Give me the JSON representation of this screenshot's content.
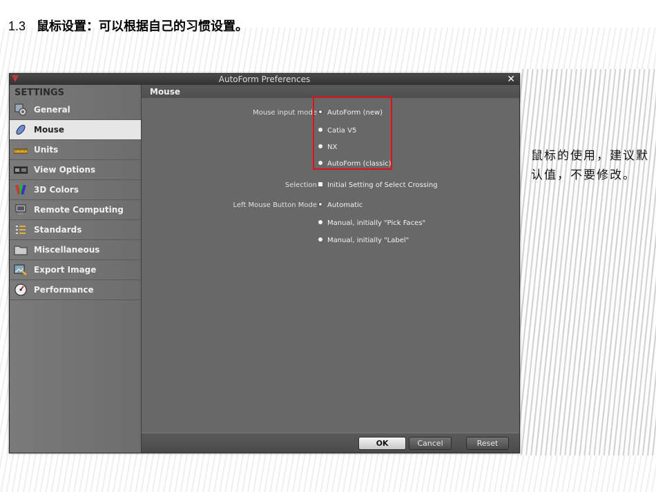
{
  "slide": {
    "section_number": "1.3",
    "title": "鼠标设置：可以根据自己的习惯设置。",
    "note": "鼠标的使用，建议默认值，不要修改。"
  },
  "window": {
    "title": "AutoForm Preferences",
    "close_label": "✕"
  },
  "sidebar": {
    "heading": "SETTINGS",
    "items": [
      {
        "label": "General",
        "icon": "general-icon"
      },
      {
        "label": "Mouse",
        "icon": "mouse-icon",
        "active": true
      },
      {
        "label": "Units",
        "icon": "ruler-icon"
      },
      {
        "label": "View Options",
        "icon": "view-options-icon"
      },
      {
        "label": "3D Colors",
        "icon": "color-palette-icon"
      },
      {
        "label": "Remote Computing",
        "icon": "remote-computing-icon"
      },
      {
        "label": "Standards",
        "icon": "standards-icon"
      },
      {
        "label": "Miscellaneous",
        "icon": "folder-icon"
      },
      {
        "label": "Export Image",
        "icon": "export-image-icon"
      },
      {
        "label": "Performance",
        "icon": "performance-gauge-icon"
      }
    ]
  },
  "main": {
    "heading": "Mouse",
    "mouse_input_mode": {
      "label": "Mouse input mode",
      "options": [
        "AutoForm (new)",
        "Catia V5",
        "NX",
        "AutoForm (classic)"
      ],
      "selected": "AutoForm (new)"
    },
    "selection": {
      "label": "Selection",
      "checkbox_label": "Initial Setting of Select Crossing"
    },
    "left_mouse_button_mode": {
      "label": "Left Mouse Button Mode",
      "options": [
        "Automatic",
        "Manual, initially \"Pick Faces\"",
        "Manual, initially \"Label\""
      ],
      "selected": "Automatic"
    }
  },
  "footer": {
    "ok": "OK",
    "cancel": "Cancel",
    "reset": "Reset"
  },
  "colors": {
    "highlight_box": "#e20f1b",
    "window_bg": "#686868",
    "sidebar_active": "#e6e6e6"
  }
}
